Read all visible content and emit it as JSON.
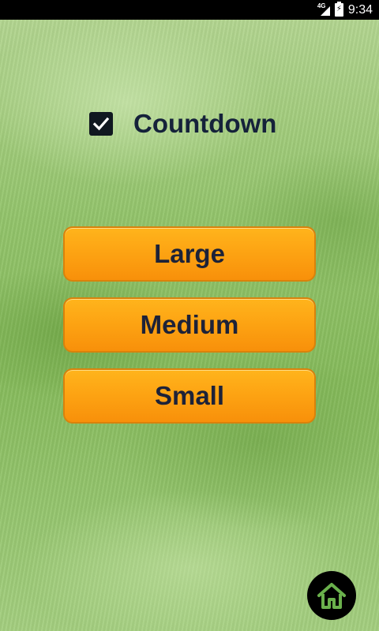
{
  "status_bar": {
    "network": "4G",
    "time": "9:34"
  },
  "countdown": {
    "label": "Countdown",
    "checked": true
  },
  "buttons": {
    "large": "Large",
    "medium": "Medium",
    "small": "Small"
  },
  "colors": {
    "button_orange": "#fda413",
    "button_border": "#d9820b",
    "text_dark_navy": "#1d2238",
    "grass_green": "#93c46b"
  },
  "icons": {
    "checkbox": "checkmark-icon",
    "home": "home-icon"
  }
}
